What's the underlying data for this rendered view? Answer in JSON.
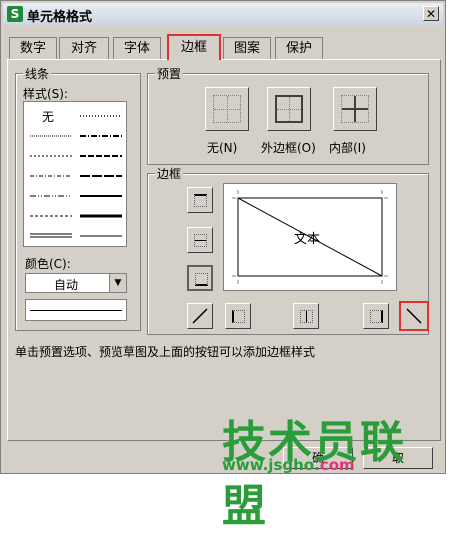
{
  "window": {
    "title": "单元格格式",
    "app_icon": "S"
  },
  "tabs": [
    {
      "label": "数字"
    },
    {
      "label": "对齐"
    },
    {
      "label": "字体"
    },
    {
      "label": "边框",
      "active": true
    },
    {
      "label": "图案"
    },
    {
      "label": "保护"
    }
  ],
  "line": {
    "group_label": "线条",
    "style_label": "样式(S):",
    "none_label": "无",
    "color_label": "颜色(C):",
    "color_value": "自动"
  },
  "preset": {
    "group_label": "预置",
    "none_label": "无(N)",
    "outline_label": "外边框(O)",
    "inside_label": "内部(I)"
  },
  "border": {
    "group_label": "边框",
    "preview_text": "文本"
  },
  "hint": "单击预置选项、预览草图及上面的按钮可以添加边框样式",
  "buttons": {
    "ok_label": "确",
    "cancel_label": "取"
  },
  "watermark": {
    "brand": "技术员联盟",
    "url_main": "www.jsgho.",
    "url_tld": "com"
  },
  "colors": {
    "accent_red": "#e03030",
    "watermark_green": "#2a9d3a"
  }
}
